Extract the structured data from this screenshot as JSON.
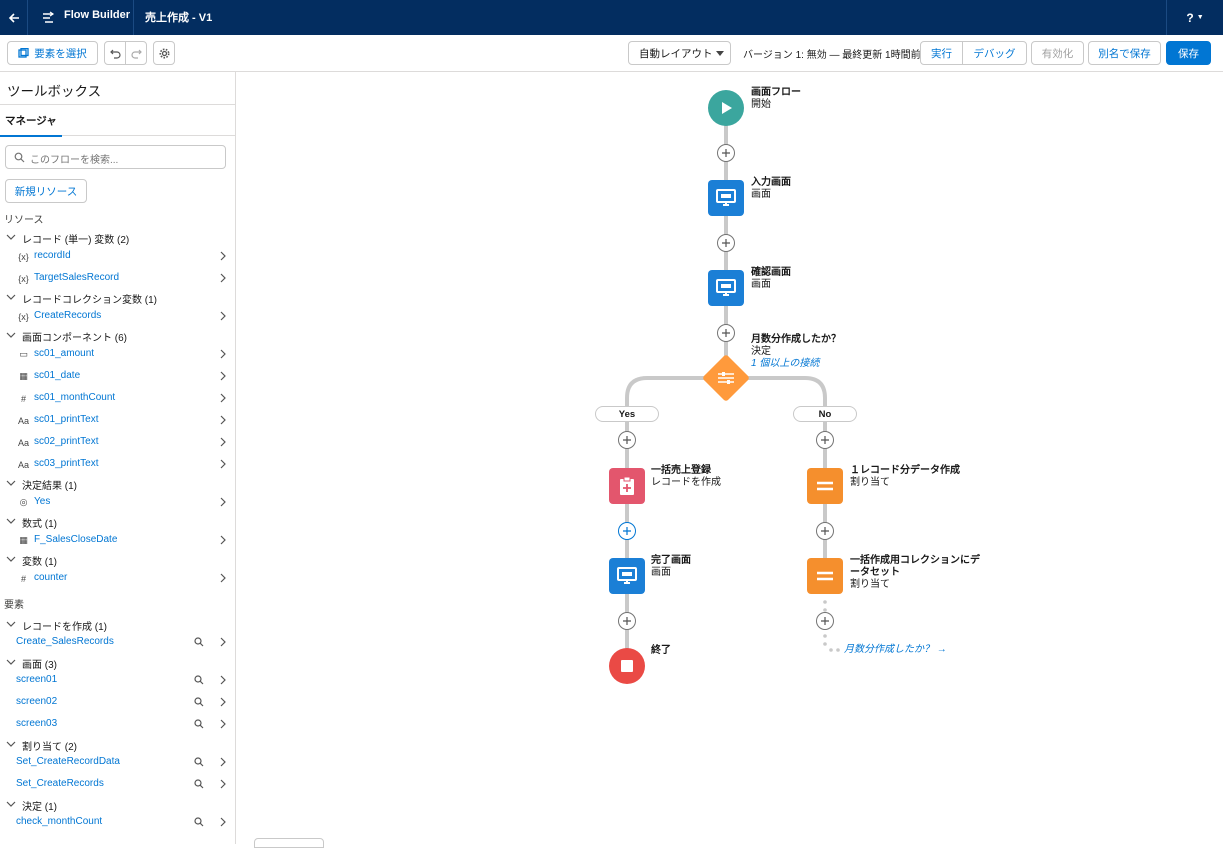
{
  "header": {
    "app_name": "Flow Builder",
    "flow_title": "売上作成 - V1",
    "help_label": "?"
  },
  "toolbar": {
    "select_elements": "要素を選択",
    "layout_value": "自動レイアウト",
    "version_info": "バージョン 1: 無効 — 最終更新 1時間前",
    "run": "実行",
    "debug": "デバッグ",
    "activate": "有効化",
    "save_as": "別名で保存",
    "save": "保存"
  },
  "sidebar": {
    "title": "ツールボックス",
    "tab": "マネージャ",
    "search_placeholder": "このフローを検索...",
    "new_resource": "新規リソース",
    "resources_header": "リソース",
    "elements_header": "要素",
    "groups": [
      {
        "label": "レコード (単一) 変数 (2)",
        "items": [
          {
            "icon": "variable-icon",
            "label": "recordId"
          },
          {
            "icon": "variable-icon",
            "label": "TargetSalesRecord"
          }
        ]
      },
      {
        "label": "レコードコレクション変数 (1)",
        "items": [
          {
            "icon": "variable-icon",
            "label": "CreateRecords"
          }
        ]
      },
      {
        "label": "画面コンポーネント (6)",
        "items": [
          {
            "icon": "currency-icon",
            "label": "sc01_amount"
          },
          {
            "icon": "calendar-icon",
            "label": "sc01_date"
          },
          {
            "icon": "number-icon",
            "label": "sc01_monthCount"
          },
          {
            "icon": "text-icon",
            "label": "sc01_printText"
          },
          {
            "icon": "text-icon",
            "label": "sc02_printText"
          },
          {
            "icon": "text-icon",
            "label": "sc03_printText"
          }
        ]
      },
      {
        "label": "決定結果 (1)",
        "items": [
          {
            "icon": "outcome-icon",
            "label": "Yes"
          }
        ]
      },
      {
        "label": "数式 (1)",
        "items": [
          {
            "icon": "calendar-icon",
            "label": "F_SalesCloseDate"
          }
        ]
      },
      {
        "label": "変数 (1)",
        "items": [
          {
            "icon": "number-icon",
            "label": "counter"
          }
        ]
      }
    ],
    "element_groups": [
      {
        "label": "レコードを作成 (1)",
        "items": [
          "Create_SalesRecords"
        ]
      },
      {
        "label": "画面 (3)",
        "items": [
          "screen01",
          "screen02",
          "screen03"
        ]
      },
      {
        "label": "割り当て (2)",
        "items": [
          "Set_CreateRecordData",
          "Set_CreateRecords"
        ]
      },
      {
        "label": "決定 (1)",
        "items": [
          "check_monthCount"
        ]
      }
    ]
  },
  "flow": {
    "start": {
      "title": "画面フロー",
      "sub": "開始",
      "color": "#3ba69e"
    },
    "input_screen": {
      "title": "入力画面",
      "sub": "画面"
    },
    "confirm_screen": {
      "title": "確認画面",
      "sub": "画面"
    },
    "decision": {
      "title": "月数分作成したか？",
      "sub": "決定",
      "link": "1 個以上の接続",
      "color": "#ff9a3c"
    },
    "yes_label": "Yes",
    "no_label": "No",
    "bulk_create": {
      "title": "一括売上登録",
      "sub": "レコードを作成",
      "color": "#e3566d"
    },
    "one_record": {
      "title": "１レコード分データ作成",
      "sub": "割り当て",
      "color": "#f58f2d"
    },
    "complete_screen": {
      "title": "完了画面",
      "sub": "画面"
    },
    "collection_set": {
      "title_line1": "一括作成用コレクションにデ",
      "title_line2": "ータセット",
      "sub": "割り当て"
    },
    "end": {
      "title": "終了",
      "color": "#ea4a45"
    },
    "loop_back": "月数分作成したか？ →",
    "screen_color": "#1b7fd6"
  }
}
